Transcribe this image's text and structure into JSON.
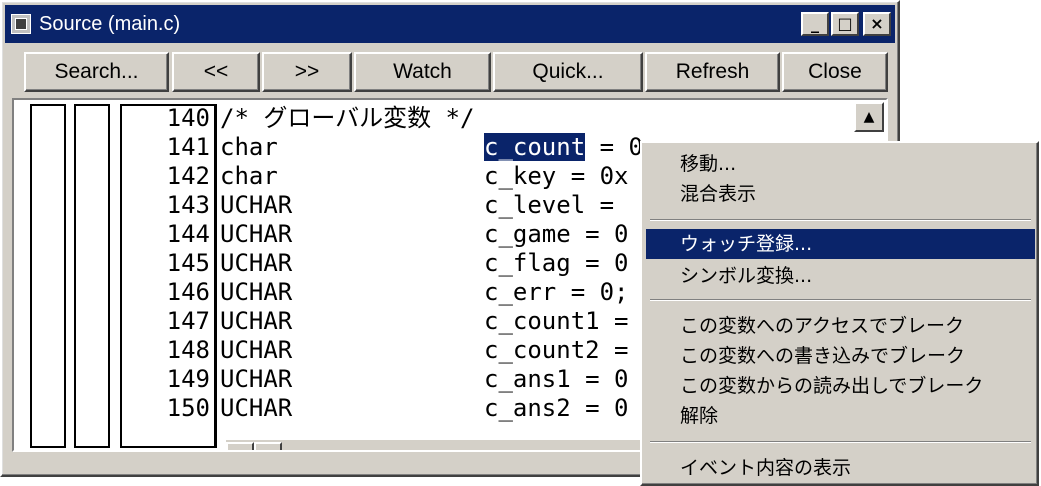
{
  "window": {
    "title": "Source (main.c)",
    "controls": {
      "minimize": "_",
      "maximize": "□",
      "close": "×"
    }
  },
  "toolbar": {
    "buttons": [
      "Search...",
      "<<",
      ">>",
      "Watch",
      "Quick...",
      "Refresh",
      "Close"
    ]
  },
  "code": {
    "lines": [
      {
        "num": "140",
        "type": "/* グローバル変数 */",
        "decl": ""
      },
      {
        "num": "141",
        "type": "char",
        "decl_sel": "c_count",
        "decl": " = 0"
      },
      {
        "num": "142",
        "type": "char",
        "decl": "c_key = 0x"
      },
      {
        "num": "143",
        "type": "UCHAR",
        "decl": "c_level ="
      },
      {
        "num": "144",
        "type": "UCHAR",
        "decl": "c_game = 0"
      },
      {
        "num": "145",
        "type": "UCHAR",
        "decl": "c_flag = 0"
      },
      {
        "num": "146",
        "type": "UCHAR",
        "decl": "c_err = 0;"
      },
      {
        "num": "147",
        "type": "UCHAR",
        "decl": "c_count1 ="
      },
      {
        "num": "148",
        "type": "UCHAR",
        "decl": "c_count2 ="
      },
      {
        "num": "149",
        "type": "UCHAR",
        "decl": "c_ans1 = 0"
      },
      {
        "num": "150",
        "type": "UCHAR",
        "decl": "c_ans2 = 0"
      }
    ]
  },
  "context_menu": {
    "items": [
      {
        "label": "移動..."
      },
      {
        "label": "混合表示"
      },
      {
        "label": "ウォッチ登録...",
        "selected": true
      },
      {
        "label": "シンボル変換..."
      },
      {
        "label": "この変数へのアクセスでブレーク"
      },
      {
        "label": "この変数への書き込みでブレーク"
      },
      {
        "label": "この変数からの読み出しでブレーク"
      },
      {
        "label": "解除"
      },
      {
        "label": "イベント内容の表示"
      }
    ]
  },
  "colors": {
    "selection": "#0a246a",
    "face": "#d4d0c8"
  }
}
